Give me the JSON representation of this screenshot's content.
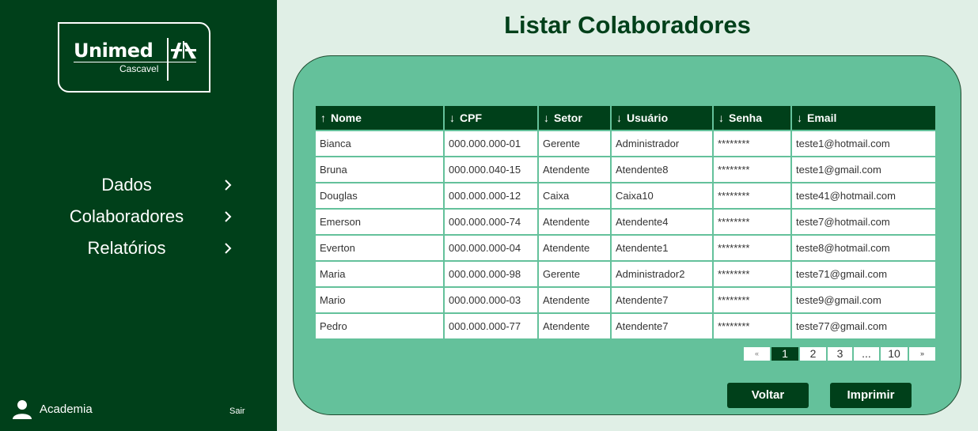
{
  "brand": {
    "name": "Unimed",
    "city": "Cascavel"
  },
  "sidebar": {
    "items": [
      {
        "label": "Dados",
        "icon": "chevron-right-icon"
      },
      {
        "label": "Colaboradores",
        "icon": "chevron-right-icon"
      },
      {
        "label": "Relatórios",
        "icon": "chevron-right-icon"
      }
    ],
    "user": {
      "name": "Academia",
      "icon": "user-icon"
    },
    "logout_label": "Sair"
  },
  "page": {
    "title": "Listar Colaboradores"
  },
  "table": {
    "columns": [
      {
        "label": "Nome",
        "sort": "↑"
      },
      {
        "label": "CPF",
        "sort": "↓"
      },
      {
        "label": "Setor",
        "sort": "↓"
      },
      {
        "label": "Usuário",
        "sort": "↓"
      },
      {
        "label": "Senha",
        "sort": "↓"
      },
      {
        "label": "Email",
        "sort": "↓"
      }
    ],
    "rows": [
      [
        "Bianca",
        "000.000.000-01",
        "Gerente",
        "Administrador",
        "********",
        "teste1@hotmail.com"
      ],
      [
        "Bruna",
        "000.000.040-15",
        "Atendente",
        "Atendente8",
        "********",
        "teste1@gmail.com"
      ],
      [
        "Douglas",
        "000.000.000-12",
        "Caixa",
        "Caixa10",
        "********",
        "teste41@hotmail.com"
      ],
      [
        "Emerson",
        "000.000.000-74",
        "Atendente",
        "Atendente4",
        "********",
        "teste7@hotmail.com"
      ],
      [
        "Everton",
        "000.000.000-04",
        "Atendente",
        "Atendente1",
        "********",
        "teste8@hotmail.com"
      ],
      [
        "Maria",
        "000.000.000-98",
        "Gerente",
        "Administrador2",
        "********",
        "teste71@gmail.com"
      ],
      [
        "Mario",
        "000.000.000-03",
        "Atendente",
        "Atendente7",
        "********",
        "teste9@gmail.com"
      ],
      [
        "Pedro",
        "000.000.000-77",
        "Atendente",
        "Atendente7",
        "********",
        "teste77@gmail.com"
      ]
    ]
  },
  "pagination": {
    "first": "«",
    "pages": [
      "1",
      "2",
      "3",
      "...",
      "10"
    ],
    "last": "»",
    "current": "1"
  },
  "actions": {
    "back_label": "Voltar",
    "print_label": "Imprimir"
  },
  "colors": {
    "sidebar": "#00401a",
    "background": "#e0efe6",
    "panel": "#64c19b",
    "accent": "#00401a"
  }
}
